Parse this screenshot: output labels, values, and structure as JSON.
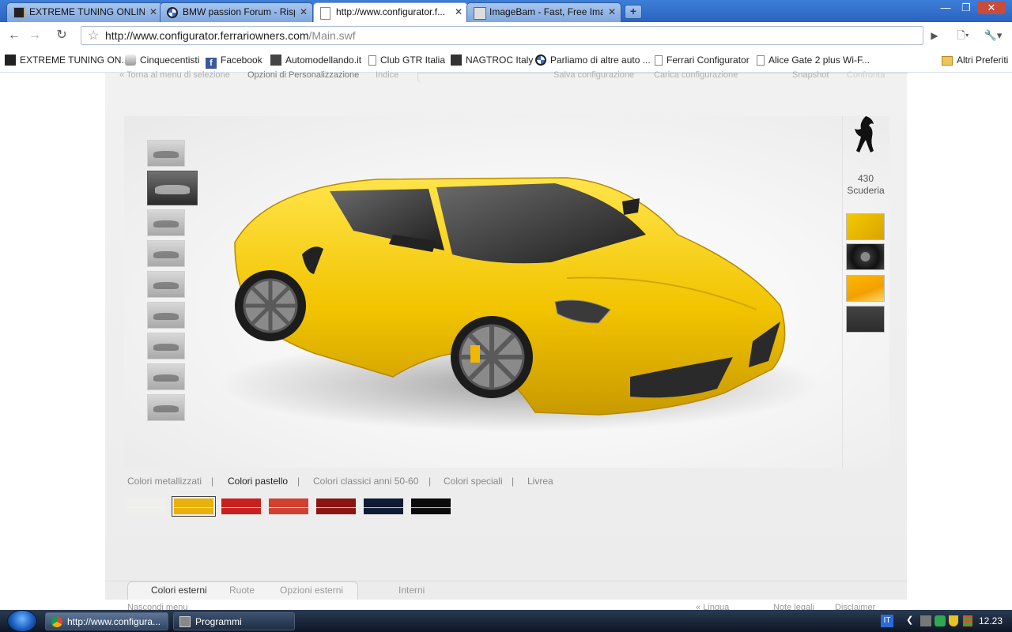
{
  "browser": {
    "tabs": [
      {
        "title": "EXTREME TUNING ONLINE ...",
        "active": false
      },
      {
        "title": "BMW passion Forum - Risp...",
        "active": false
      },
      {
        "title": "http://www.configurator.f...",
        "active": true
      },
      {
        "title": "ImageBam - Fast, Free Ima...",
        "active": false
      }
    ],
    "new_tab_label": "+",
    "window_controls": {
      "minimize": "—",
      "restore": "❐",
      "close": "✕"
    },
    "toolbar": {
      "back": "←",
      "forward": "→",
      "reload": "↻",
      "star": "☆",
      "go": "▶",
      "page_menu": "🗋▾",
      "tools_menu": "🔧▾"
    },
    "url": {
      "host": "http://www.configurator.ferrariowners.com",
      "path": "/Main.swf"
    },
    "bookmarks": [
      "EXTREME TUNING ON...",
      "Cinquecentisti",
      "Facebook",
      "Automodellando.it",
      "Club GTR Italia",
      "NAGTROC Italy",
      "Parliamo di altre auto ...",
      "Ferrari Configurator",
      "Alice Gate 2 plus Wi-F..."
    ],
    "other_bookmarks": "Altri Preferiti"
  },
  "configurator": {
    "top_links_left": [
      "« Torna al menu di selezione",
      "Opzioni di Personalizzazione",
      "Indice"
    ],
    "top_links_right": [
      "Salva configurazione",
      "Carica configurazione",
      "Snapshot",
      "Confronta"
    ],
    "model_number": "430",
    "model_name": "Scuderia",
    "color_categories": [
      "Colori metallizzati",
      "Colori pastello",
      "Colori classici anni 50-60",
      "Colori speciali",
      "Livrea"
    ],
    "selected_category": "Colori pastello",
    "separator": "|",
    "swatches": [
      "#efefeb",
      "#e8b10c",
      "#c8201e",
      "#d04130",
      "#8a1512",
      "#0f1a33",
      "#0b0b0b"
    ],
    "selected_swatch_color": "#e8b10c",
    "thumbnail_count": 9,
    "selected_thumbnail_index": 1,
    "bottom_tabs": [
      "Colori esterni",
      "Ruote",
      "Opzioni esterni",
      "Interni"
    ],
    "selected_bottom_tab": "Colori esterni",
    "bottom_links": [
      "Nascondi menu",
      "« Lingua",
      "Note legali",
      "Disclaimer"
    ],
    "car_color": "#f2c400"
  },
  "taskbar": {
    "tasks": [
      "http://www.configura...",
      "Programmi"
    ],
    "language": "IT",
    "clock": "12.23"
  }
}
